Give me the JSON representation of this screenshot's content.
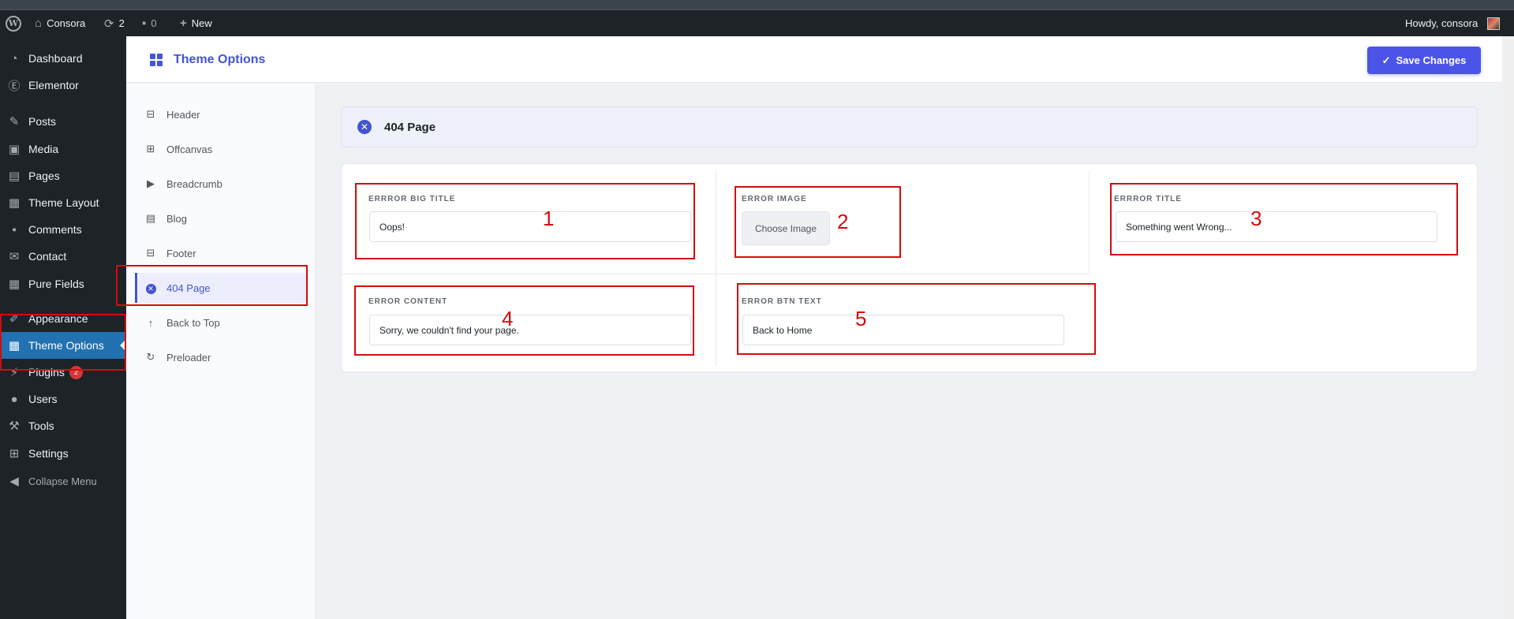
{
  "adminbar": {
    "site_name": "Consora",
    "updates_count": "2",
    "comments_count": "0",
    "new_label": "New",
    "howdy": "Howdy, consora"
  },
  "wp_menu": {
    "items": [
      {
        "label": "Dashboard",
        "icon": "dashboard-icon"
      },
      {
        "label": "Elementor",
        "icon": "elementor-icon"
      },
      {
        "label": "Posts",
        "icon": "pin-icon"
      },
      {
        "label": "Media",
        "icon": "media-icon"
      },
      {
        "label": "Pages",
        "icon": "pages-icon"
      },
      {
        "label": "Theme Layout",
        "icon": "layout-icon"
      },
      {
        "label": "Comments",
        "icon": "comment-icon"
      },
      {
        "label": "Contact",
        "icon": "mail-icon"
      },
      {
        "label": "Pure Fields",
        "icon": "grid-icon"
      },
      {
        "label": "Appearance",
        "icon": "brush-icon"
      },
      {
        "label": "Theme Options",
        "icon": "grid-icon"
      },
      {
        "label": "Plugins",
        "icon": "plugin-icon",
        "badge": "2"
      },
      {
        "label": "Users",
        "icon": "user-icon"
      },
      {
        "label": "Tools",
        "icon": "wrench-icon"
      },
      {
        "label": "Settings",
        "icon": "settings-icon"
      },
      {
        "label": "Collapse Menu",
        "icon": "collapse-icon"
      }
    ]
  },
  "theme_options": {
    "title": "Theme Options",
    "save_label": "Save Changes",
    "nav": [
      {
        "label": "Header",
        "icon": "header-icon"
      },
      {
        "label": "Offcanvas",
        "icon": "offcanvas-icon"
      },
      {
        "label": "Breadcrumb",
        "icon": "breadcrumb-icon"
      },
      {
        "label": "Blog",
        "icon": "blog-icon"
      },
      {
        "label": "Footer",
        "icon": "footer-icon"
      },
      {
        "label": "404 Page",
        "icon": "close-circle-icon"
      },
      {
        "label": "Back to Top",
        "icon": "arrow-up-icon"
      },
      {
        "label": "Preloader",
        "icon": "refresh-icon"
      }
    ],
    "section_title": "404 Page",
    "fields": {
      "big_title": {
        "label": "ERRROR BIG TITLE",
        "value": "Oops!"
      },
      "image": {
        "label": "ERROR IMAGE",
        "button": "Choose Image"
      },
      "title": {
        "label": "ERRROR TITLE",
        "value": "Something went Wrong..."
      },
      "content": {
        "label": "ERROR CONTENT",
        "value": "Sorry, we couldn't find your page."
      },
      "btn_text": {
        "label": "ERROR BTN TEXT",
        "value": "Back to Home"
      }
    }
  },
  "annotations": [
    "1",
    "2",
    "3",
    "4",
    "5"
  ],
  "colors": {
    "accent": "#4255d4",
    "annotation": "#d40c0c",
    "wp_current": "#2271b1"
  }
}
